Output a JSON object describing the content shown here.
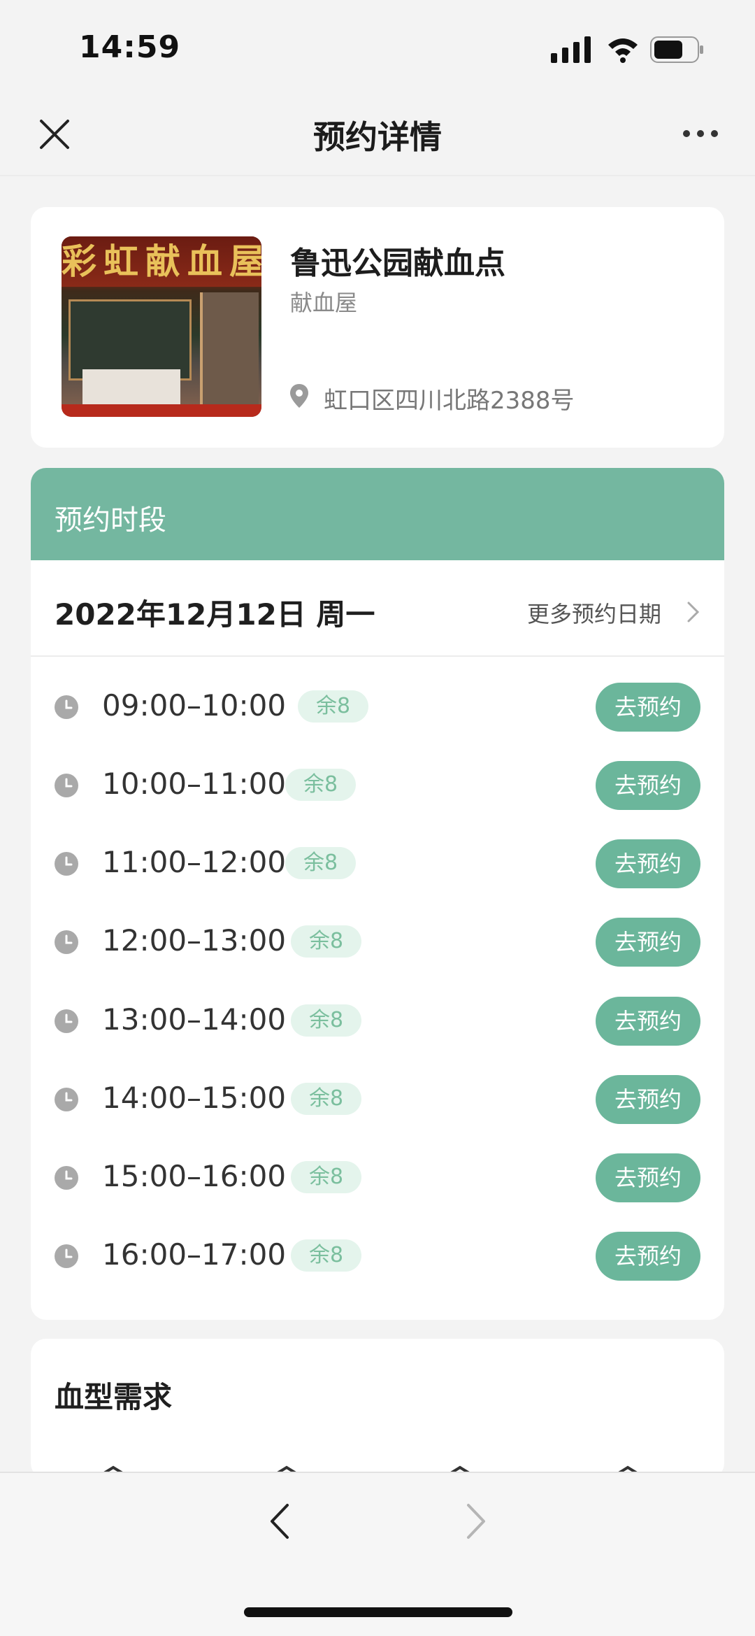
{
  "status_bar": {
    "time": "14:59"
  },
  "nav": {
    "title": "预约详情"
  },
  "venue": {
    "name": "鲁迅公园献血点",
    "type": "献血屋",
    "address": "虹口区四川北路2388号",
    "photo_sign_text": "彩虹献血屋"
  },
  "slots": {
    "header": "预约时段",
    "date": "2022年12月12日 周一",
    "more_dates": "更多预约日期",
    "rows": [
      {
        "time": "09:00–10:00",
        "remaining": "余8",
        "action": "去预约"
      },
      {
        "time": "10:00–11:00",
        "remaining": "余8",
        "action": "去预约"
      },
      {
        "time": "11:00–12:00",
        "remaining": "余8",
        "action": "去预约"
      },
      {
        "time": "12:00–13:00",
        "remaining": "余8",
        "action": "去预约"
      },
      {
        "time": "13:00–14:00",
        "remaining": "余8",
        "action": "去预约"
      },
      {
        "time": "14:00–15:00",
        "remaining": "余8",
        "action": "去预约"
      },
      {
        "time": "15:00–16:00",
        "remaining": "余8",
        "action": "去预约"
      },
      {
        "time": "16:00–17:00",
        "remaining": "余8",
        "action": "去预约"
      }
    ]
  },
  "blood": {
    "title": "血型需求"
  },
  "colors": {
    "accent": "#6bb69b",
    "header_green": "#74b7a0",
    "badge_bg": "#e4f4ec",
    "badge_text": "#7bbf9e"
  },
  "icons": [
    "close-icon",
    "more-icon",
    "signal-icon",
    "wifi-icon",
    "battery-icon",
    "location-pin-icon",
    "chevron-right-icon",
    "clock-icon",
    "back-arrow-icon",
    "forward-arrow-icon"
  ]
}
